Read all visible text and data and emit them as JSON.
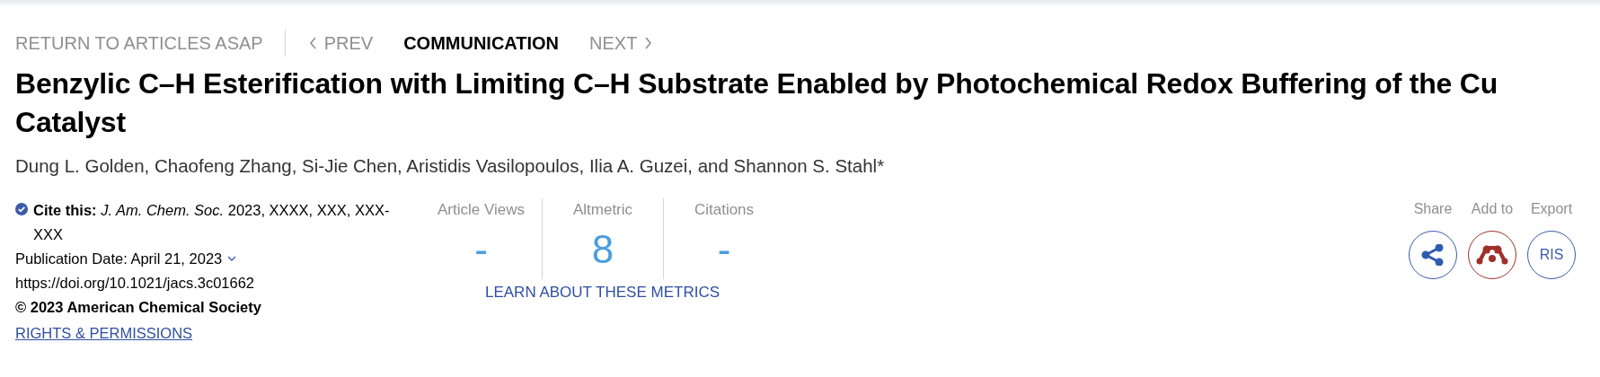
{
  "nav": [
    {
      "kind": "link",
      "label": "RETURN TO ARTICLES ASAP"
    },
    {
      "kind": "prev",
      "label": "PREV"
    },
    {
      "kind": "current",
      "label": "COMMUNICATION"
    },
    {
      "kind": "next",
      "label": "NEXT"
    }
  ],
  "title": "Benzylic C–H Esterification with Limiting C–H Substrate Enabled by Photochemical Redox Buffering of the Cu Catalyst",
  "authors": "Dung L. Golden, Chaofeng Zhang, Si-Jie Chen, Aristidis Vasilopoulos, Ilia A. Guzei, and Shannon S. Stahl*",
  "citation": {
    "text": "**Cite this:** *J. Am. Chem. Soc.* 2023, XXXX, XXX, XXX-XXX",
    "publication_date": "Publication Date: April 21, 2023",
    "doi": "https://doi.org/10.1021/jacs.3c01662",
    "copyright": "© 2023 American Chemical Society",
    "rights_link": "RIGHTS & PERMISSIONS"
  },
  "metrics": [
    {
      "label": "Article Views",
      "value": "-"
    },
    {
      "label": "Altmetric",
      "value": "8"
    },
    {
      "label": "Citations",
      "value": "-"
    }
  ],
  "metrics_link": "LEARN ABOUT THESE METRICS",
  "actions": [
    {
      "kind": "share",
      "label": "Share"
    },
    {
      "kind": "mendeley",
      "label": "Add to"
    },
    {
      "kind": "ris",
      "label": "Export",
      "button": "RIS"
    }
  ]
}
